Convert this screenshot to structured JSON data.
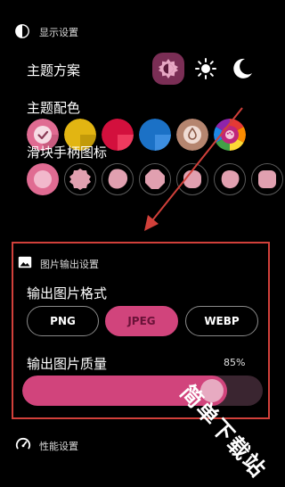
{
  "display_section": {
    "title": "显示设置",
    "icon": "contrast-icon"
  },
  "theme_scheme": {
    "label": "主题方案",
    "options": [
      {
        "name": "auto",
        "icon": "contrast-icon",
        "selected": true
      },
      {
        "name": "light",
        "icon": "sun-icon",
        "selected": false
      },
      {
        "name": "dark",
        "icon": "moon-icon",
        "selected": false
      }
    ]
  },
  "theme_color": {
    "label": "主题配色",
    "swatches": [
      {
        "name": "pink",
        "color": "#e06b92",
        "selected": true
      },
      {
        "name": "yellow",
        "color": "#e2b512",
        "selected": false
      },
      {
        "name": "crimson",
        "color": "#d3103d",
        "selected": false
      },
      {
        "name": "blue",
        "color": "#1b71c6",
        "selected": false
      },
      {
        "name": "wallpaper",
        "color": "#b5856f",
        "selected": false
      },
      {
        "name": "custom",
        "color": "#c0267a",
        "selected": false
      }
    ]
  },
  "slider_thumb": {
    "label": "滑块手柄图标",
    "count": 7,
    "selected_index": 0
  },
  "image_output_section": {
    "title": "图片输出设置",
    "icon": "image-icon"
  },
  "output_format": {
    "label": "输出图片格式",
    "options": [
      "PNG",
      "JPEG",
      "WEBP"
    ],
    "selected": "JPEG"
  },
  "output_quality": {
    "label": "输出图片质量",
    "value_text": "85%",
    "value": 0.85
  },
  "performance_section": {
    "title": "性能设置",
    "icon": "speedometer-icon"
  },
  "watermark": {
    "text": "简单下载站"
  },
  "colors": {
    "accent": "#d1447c",
    "annotation_red": "#d1403a",
    "background": "#000000"
  }
}
